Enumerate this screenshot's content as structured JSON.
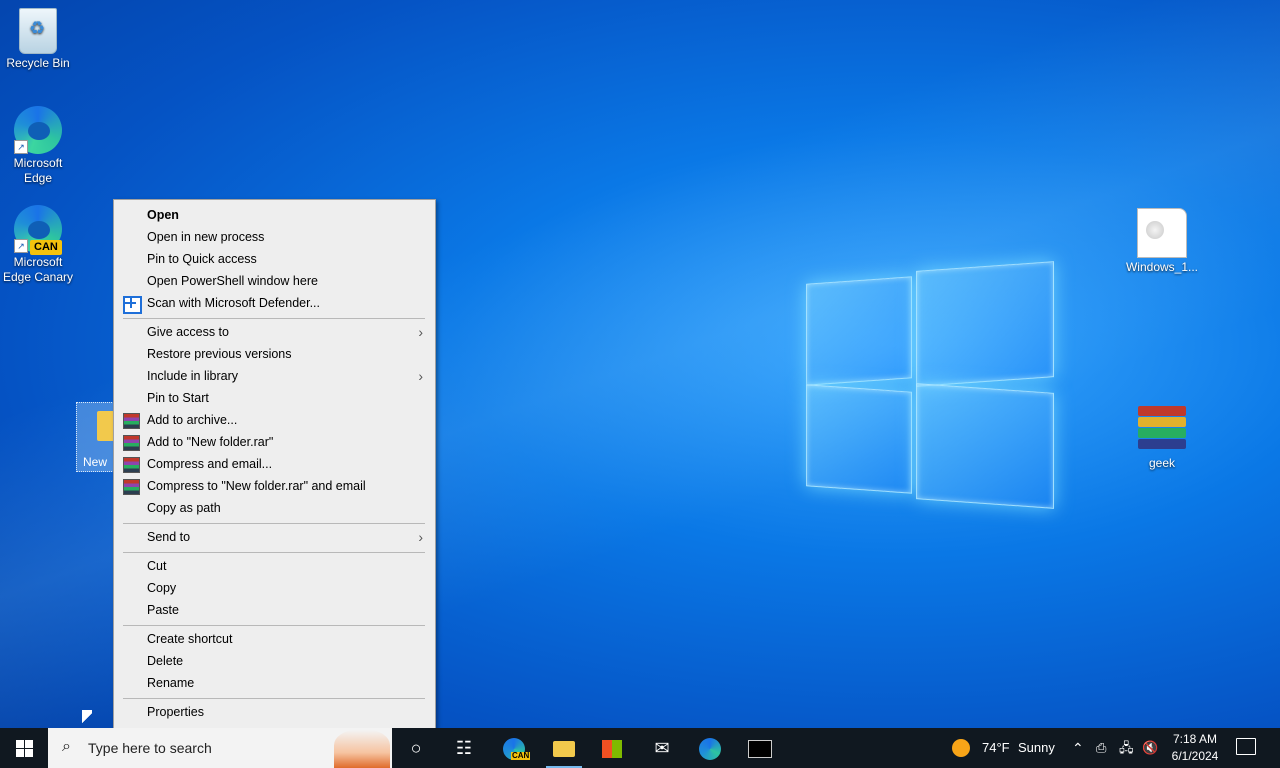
{
  "desktop": {
    "icons": {
      "recycle_bin": "Recycle Bin",
      "edge": "Microsoft Edge",
      "edge_canary": "Microsoft Edge Canary",
      "edge_canary_badge": "CAN",
      "windows_file": "Windows_1...",
      "geek": "geek",
      "new_folder": "New"
    }
  },
  "context_menu": {
    "items": [
      {
        "label": "Open",
        "bold": true
      },
      {
        "label": "Open in new process"
      },
      {
        "label": "Pin to Quick access"
      },
      {
        "label": "Open PowerShell window here"
      },
      {
        "label": "Scan with Microsoft Defender...",
        "icon": "defender-icon"
      },
      {
        "label": "Give access to",
        "submenu": true
      },
      {
        "label": "Restore previous versions"
      },
      {
        "label": "Include in library",
        "submenu": true
      },
      {
        "label": "Pin to Start"
      },
      {
        "label": "Add to archive...",
        "icon": "winrar-icon"
      },
      {
        "label": "Add to \"New folder.rar\"",
        "icon": "winrar-icon"
      },
      {
        "label": "Compress and email...",
        "icon": "winrar-icon"
      },
      {
        "label": "Compress to \"New folder.rar\" and email",
        "icon": "winrar-icon"
      },
      {
        "label": "Copy as path"
      },
      {
        "label": "Send to",
        "submenu": true
      },
      {
        "label": "Cut"
      },
      {
        "label": "Copy"
      },
      {
        "label": "Paste"
      },
      {
        "label": "Create shortcut"
      },
      {
        "label": "Delete"
      },
      {
        "label": "Rename"
      },
      {
        "label": "Properties"
      }
    ]
  },
  "taskbar": {
    "search_placeholder": "Type here to search",
    "weather_temp": "74°F",
    "weather_desc": "Sunny",
    "time": "7:18 AM",
    "date": "6/1/2024",
    "canary_badge": "CAN"
  }
}
